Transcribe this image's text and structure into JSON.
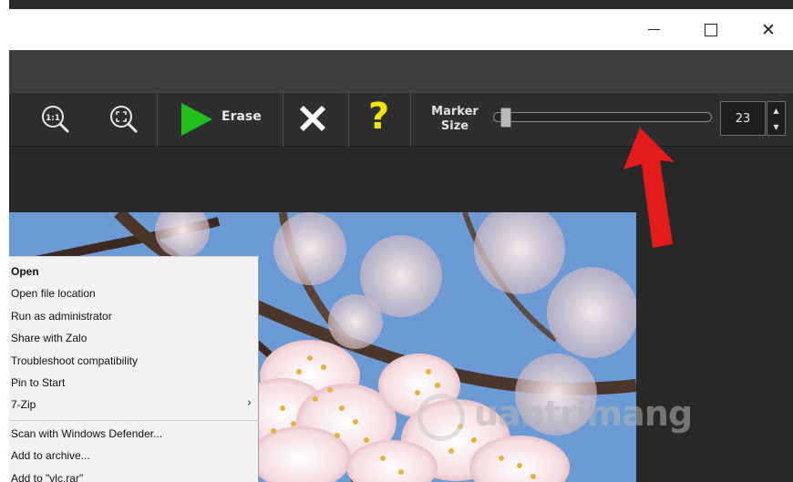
{
  "window": {
    "controls": {
      "minimize": "minimize-icon",
      "maximize": "maximize-icon",
      "close": "close-icon",
      "close_glyph": "✕"
    }
  },
  "toolbar": {
    "zoom_actual_icon": "zoom-actual-size-icon",
    "zoom_actual_glyph": "1:1",
    "zoom_fit_icon": "zoom-fit-icon",
    "erase_label": "Erase",
    "erase_icon": "play-icon",
    "cancel_icon": "x-icon",
    "help_icon": "question-icon",
    "help_glyph": "?",
    "marker_size_label": "Marker Size",
    "marker_size_value": "23",
    "spin_up_glyph": "▲",
    "spin_down_glyph": "▼",
    "colors": {
      "erase_green": "#22c01e",
      "help_yellow": "#f4e500",
      "annotation_arrow": "#e31b1b"
    }
  },
  "context_menu": {
    "items": [
      {
        "label": "Open",
        "bold": true
      },
      {
        "label": "Open file location"
      },
      {
        "label": "Run as administrator"
      },
      {
        "label": "Share with Zalo"
      },
      {
        "label": "Troubleshoot compatibility"
      },
      {
        "label": "Pin to Start"
      },
      {
        "label": "7-Zip",
        "submenu": true
      },
      {
        "label": "Scan with Windows Defender..."
      },
      {
        "label": "Add to archive..."
      },
      {
        "label": "Add to \"vlc.rar\""
      }
    ],
    "chevron_glyph": "›"
  },
  "watermark": {
    "text": "uantrimang"
  }
}
